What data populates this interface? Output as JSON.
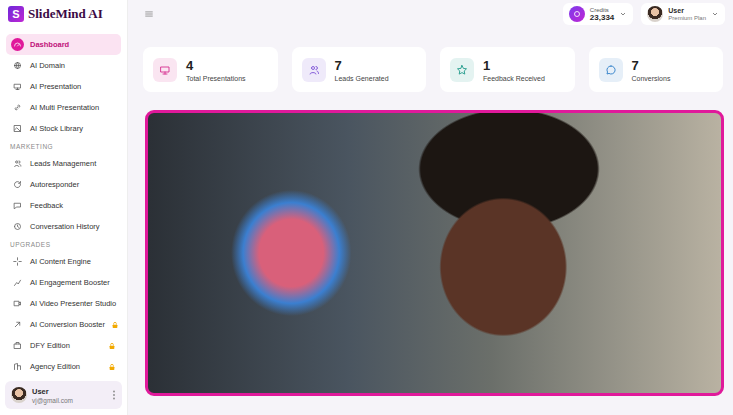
{
  "logo": {
    "mark": "S",
    "name": "SlideMind AI"
  },
  "header": {
    "credits": {
      "label": "Credits",
      "value": "23,334"
    },
    "user": {
      "name": "User",
      "plan": "Premium Plan"
    }
  },
  "sidebar": {
    "groups": [
      {
        "title": "",
        "items": [
          {
            "label": "Dashboard",
            "selected": true,
            "locked": false
          },
          {
            "label": "AI Domain",
            "selected": false,
            "locked": false
          },
          {
            "label": "AI Presentation",
            "selected": false,
            "locked": false
          },
          {
            "label": "AI Multi Presentation",
            "selected": false,
            "locked": false
          },
          {
            "label": "AI Stock Library",
            "selected": false,
            "locked": false
          }
        ]
      },
      {
        "title": "MARKETING",
        "items": [
          {
            "label": "Leads Management",
            "selected": false,
            "locked": false
          },
          {
            "label": "Autoresponder",
            "selected": false,
            "locked": false
          },
          {
            "label": "Feedback",
            "selected": false,
            "locked": false
          },
          {
            "label": "Conversation History",
            "selected": false,
            "locked": false
          }
        ]
      },
      {
        "title": "UPGRADES",
        "items": [
          {
            "label": "AI Content Engine",
            "selected": false,
            "locked": false
          },
          {
            "label": "AI Engagement Booster",
            "selected": false,
            "locked": false
          },
          {
            "label": "AI Video Presenter Studio",
            "selected": false,
            "locked": false
          },
          {
            "label": "AI Conversion Booster",
            "selected": false,
            "locked": true
          },
          {
            "label": "DFY Edition",
            "selected": false,
            "locked": true
          },
          {
            "label": "Agency Edition",
            "selected": false,
            "locked": true
          }
        ]
      }
    ],
    "account": {
      "name": "User",
      "email": "vj@gmail.com"
    }
  },
  "stats": [
    {
      "value": "4",
      "label": "Total Presentations",
      "color": "#d62c8f"
    },
    {
      "value": "7",
      "label": "Leads Generated",
      "color": "#7b4fd6"
    },
    {
      "value": "1",
      "label": "Feedback Received",
      "color": "#1f9a8a"
    },
    {
      "value": "7",
      "label": "Conversions",
      "color": "#2f7fc8"
    }
  ]
}
